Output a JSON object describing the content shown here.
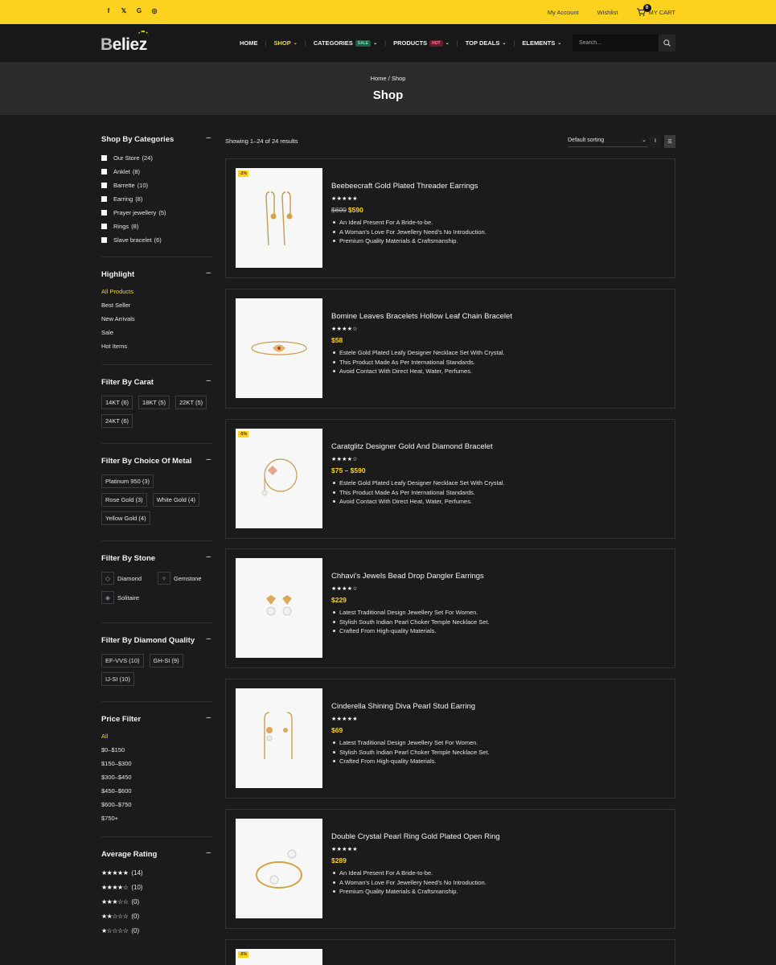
{
  "topbar": {
    "social": [
      "f",
      "𝕏",
      "G",
      "◎"
    ],
    "social_icons": [
      "facebook-icon",
      "x-icon",
      "google-icon",
      "instagram-icon"
    ],
    "my_account": "My Account",
    "wishlist": "Wishlist",
    "cart_count": "0",
    "cart_label": "MY CART"
  },
  "header": {
    "logo_b": "B",
    "logo_rest": "eliez",
    "nav": [
      {
        "label": "HOME"
      },
      {
        "label": "SHOP"
      },
      {
        "label": "CATEGORIES",
        "badge": "SALE"
      },
      {
        "label": "PRODUCTS",
        "badge": "HOT"
      },
      {
        "label": "TOP DEALS"
      },
      {
        "label": "ELEMENTS"
      }
    ],
    "search_placeholder": "Search..."
  },
  "banner": {
    "crumb_home": "Home",
    "crumb_sep": "/",
    "crumb_current": "Shop",
    "title": "Shop"
  },
  "sidebar": {
    "categories": {
      "title": "Shop By Categories",
      "items": [
        {
          "name": "Our Store",
          "count": "(24)"
        },
        {
          "name": "Anklet",
          "count": "(8)"
        },
        {
          "name": "Barrette",
          "count": "(10)"
        },
        {
          "name": "Earring",
          "count": "(8)"
        },
        {
          "name": "Prayer jewellery",
          "count": "(5)"
        },
        {
          "name": "Rings",
          "count": "(8)"
        },
        {
          "name": "Slave bracelet",
          "count": "(6)"
        }
      ]
    },
    "highlight": {
      "title": "Highlight",
      "items": [
        "All Products",
        "Best Seller",
        "New Arrivals",
        "Sale",
        "Hot Items"
      ]
    },
    "carat": {
      "title": "Filter By Carat",
      "items": [
        "14KT (6)",
        "18KT (5)",
        "22KT (5)",
        "24KT (6)"
      ]
    },
    "metal": {
      "title": "Filter By Choice Of Metal",
      "items": [
        "Platinum 950 (3)",
        "Rose Gold (3)",
        "White Gold (4)",
        "Yellow Gold (4)"
      ]
    },
    "stone": {
      "title": "Filter By Stone",
      "items": [
        "Diamond",
        "Gemstone",
        "Solitaire"
      ]
    },
    "quality": {
      "title": "Filter By Diamond Quality",
      "items": [
        "EF-VVS (10)",
        "GH-SI (9)",
        "IJ-SI (10)"
      ]
    },
    "price": {
      "title": "Price Filter",
      "items": [
        "All",
        "$0–$150",
        "$150–$300",
        "$300–$450",
        "$450–$600",
        "$600–$750",
        "$750+"
      ]
    },
    "rating": {
      "title": "Average Rating",
      "items": [
        {
          "stars": "★★★★★",
          "count": "(14)"
        },
        {
          "stars": "★★★★☆",
          "count": "(10)"
        },
        {
          "stars": "★★★☆☆",
          "count": "(0)"
        },
        {
          "stars": "★★☆☆☆",
          "count": "(0)"
        },
        {
          "stars": "★☆☆☆☆",
          "count": "(0)"
        }
      ]
    }
  },
  "toolbar": {
    "showing": "Showing 1–24 of 24 results",
    "sort": "Default sorting"
  },
  "products": [
    {
      "name": "Beebeecraft Gold Plated Threader Earrings",
      "stars": "★★★★★",
      "old_price": "$600",
      "price": "$590",
      "discount": "-2%",
      "features": [
        "An Ideal Present For A Bride-to-be.",
        "A Woman's Love For Jewellery Need's No Introduction.",
        "Premium Quality Materials & Craftsmanship."
      ]
    },
    {
      "name": "Bomine Leaves Bracelets Hollow Leaf Chain Bracelet",
      "stars": "★★★★☆",
      "old_price": "",
      "price": "$58",
      "discount": "",
      "features": [
        "Estele Gold Plated Leafy Designer Necklace Set With Crystal.",
        "This Product Made As Per International Standards.",
        "Avoid Contact With Direct Heat, Water, Perfumes."
      ]
    },
    {
      "name": "Caratglitz Designer Gold And Diamond Bracelet",
      "stars": "★★★★☆",
      "old_price": "",
      "price": "$75 – $590",
      "discount": "-5%",
      "features": [
        "Estele Gold Plated Leafy Designer Necklace Set With Crystal.",
        "This Product Made As Per International Standards.",
        "Avoid Contact With Direct Heat, Water, Perfumes."
      ]
    },
    {
      "name": "Chhavi's Jewels Bead Drop Dangler Earrings",
      "stars": "★★★★☆",
      "old_price": "",
      "price": "$229",
      "discount": "",
      "features": [
        "Latest Traditional Design Jewellery Set For Women.",
        "Stylish South Indian Pearl Choker Temple Necklace Set.",
        "Crafted From High-quality Materials."
      ]
    },
    {
      "name": "Cinderella Shining Diva Pearl Stud Earring",
      "stars": "★★★★★",
      "old_price": "",
      "price": "$69",
      "discount": "",
      "features": [
        "Latest Traditional Design Jewellery Set For Women.",
        "Stylish South Indian Pearl Choker Temple Necklace Set.",
        "Crafted From High-quality Materials."
      ]
    },
    {
      "name": "Double Crystal Pearl Ring Gold Plated Open Ring",
      "stars": "★★★★★",
      "old_price": "",
      "price": "$289",
      "discount": "",
      "features": [
        "An Ideal Present For A Bride-to-be.",
        "A Woman's Love For Jewellery Need's No Introduction.",
        "Premium Quality Materials & Craftsmanship."
      ]
    },
    {
      "name": "",
      "stars": "",
      "old_price": "",
      "price": "",
      "discount": "-5%",
      "features": []
    }
  ]
}
